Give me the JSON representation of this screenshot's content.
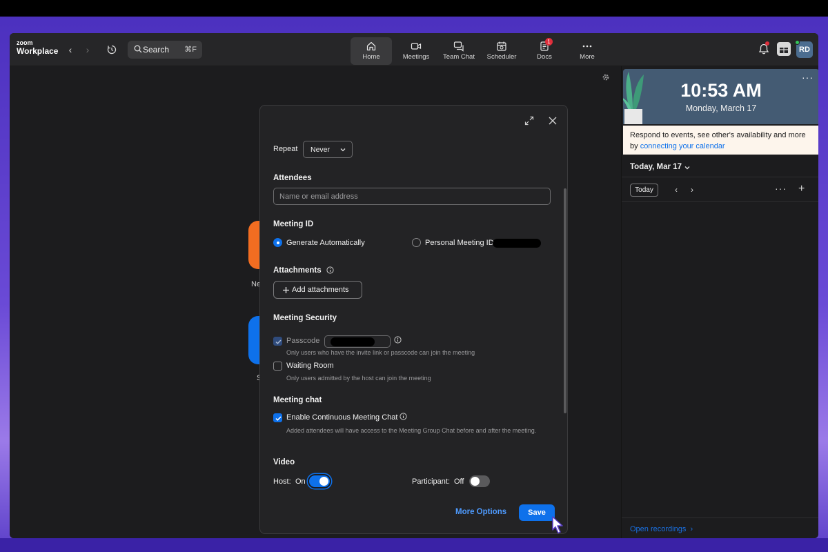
{
  "app": {
    "logo_small": "zoom",
    "logo_big": "Workplace"
  },
  "search": {
    "label": "Search",
    "shortcut": "⌘F"
  },
  "tabs": [
    {
      "label": "Home",
      "icon": "home-icon",
      "active": true
    },
    {
      "label": "Meetings",
      "icon": "video-icon"
    },
    {
      "label": "Team Chat",
      "icon": "chat-icon"
    },
    {
      "label": "Scheduler",
      "icon": "calendar-icon"
    },
    {
      "label": "Docs",
      "icon": "docs-icon",
      "badge": "1"
    },
    {
      "label": "More",
      "icon": "more-icon"
    }
  ],
  "user": {
    "initials": "RD",
    "status_color": "#34c759"
  },
  "background": {
    "new_label": "Ne",
    "s_label": "S"
  },
  "dialog": {
    "repeat_label": "Repeat",
    "repeat_value": "Never",
    "attendees_title": "Attendees",
    "attendees_placeholder": "Name or email address",
    "meeting_id_title": "Meeting ID",
    "generate_auto": "Generate Automatically",
    "personal_id": "Personal Meeting ID",
    "attachments_title": "Attachments",
    "add_attachments": "Add attachments",
    "security_title": "Meeting Security",
    "passcode_label": "Passcode",
    "passcode_hint": "Only users who have the invite link or passcode can join the meeting",
    "waiting_room_label": "Waiting Room",
    "waiting_room_hint": "Only users admitted by the host can join the meeting",
    "chat_title": "Meeting chat",
    "continuous_chat_label": "Enable Continuous Meeting Chat",
    "continuous_chat_hint": "Added attendees will have access to the Meeting Group Chat before and after the meeting.",
    "video_title": "Video",
    "host_label": "Host:",
    "host_value": "On",
    "participant_label": "Participant:",
    "participant_value": "Off",
    "more_options": "More Options",
    "save": "Save"
  },
  "panel": {
    "time": "10:53 AM",
    "date": "Monday, March 17",
    "cal_note_text": "Respond to events, see other's availability and more by ",
    "cal_note_link": "connecting your calendar",
    "today_header": "Today, Mar 17",
    "today_button": "Today",
    "open_recordings": "Open recordings"
  },
  "colors": {
    "accent": "#0e71eb",
    "badge": "#e02e3b",
    "clock_bg": "#445b73"
  }
}
